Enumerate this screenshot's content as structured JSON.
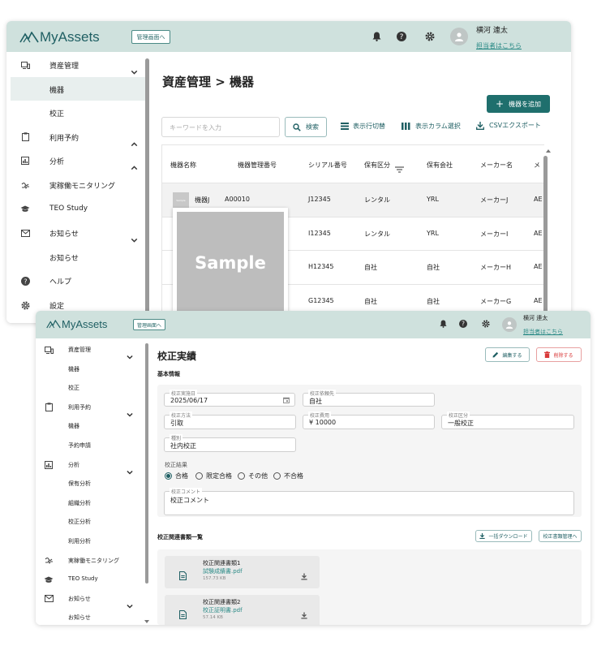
{
  "app": {
    "logo_text": "MyAssets",
    "mgmt_button": "管理画面へ",
    "user_name": "横河 連太",
    "contact_link": "担当者はこちら"
  },
  "colors": {
    "accent": "#1f6f6d",
    "header_bg": "#cfe1dd",
    "danger": "#d93a3a"
  },
  "win1": {
    "sidebar": [
      {
        "icon": "asset-icon",
        "label": "資産管理",
        "chevron": "down"
      },
      {
        "icon": "",
        "label": "機器",
        "selected": true
      },
      {
        "icon": "",
        "label": "校正"
      },
      {
        "icon": "clipboard-icon",
        "label": "利用予約",
        "chevron": "up"
      },
      {
        "icon": "chart-icon",
        "label": "分析",
        "chevron": "up"
      },
      {
        "icon": "monitor-icon",
        "label": "実稼働モニタリング"
      },
      {
        "icon": "graduation-icon",
        "label": "TEO Study"
      },
      {
        "icon": "mail-icon",
        "label": "お知らせ",
        "chevron": "down"
      },
      {
        "icon": "",
        "label": "お知らせ"
      },
      {
        "icon": "help-icon",
        "label": "ヘルプ"
      },
      {
        "icon": "gear-icon",
        "label": "設定"
      }
    ],
    "page_title": "資産管理 > 機器",
    "add_button": "機器を追加",
    "search_placeholder": "キーワードを入力",
    "search_button": "検索",
    "toolbar": {
      "rows_toggle": "表示行切替",
      "column_select": "表示カラム選択",
      "csv_export": "CSVエクスポート"
    },
    "table": {
      "headers": [
        "機器名称",
        "機器管理番号",
        "シリアル番号",
        "保有区分",
        "保有会社",
        "メーカー名",
        "メ"
      ],
      "rows": [
        [
          "機器J",
          "A00010",
          "J12345",
          "レンタル",
          "YRL",
          "メーカーJ",
          "AE"
        ],
        [
          "",
          "",
          "I12345",
          "レンタル",
          "YRL",
          "メーカーI",
          "AE"
        ],
        [
          "",
          "",
          "H12345",
          "自社",
          "自社",
          "メーカーH",
          "AE"
        ],
        [
          "",
          "",
          "G12345",
          "自社",
          "自社",
          "メーカーG",
          "AE"
        ]
      ],
      "thumb_text": "Sample",
      "popup_text": "Sample"
    }
  },
  "win2": {
    "sidebar": [
      {
        "icon": "asset-icon",
        "label": "資産管理",
        "chevron": "down"
      },
      {
        "icon": "",
        "label": "機器"
      },
      {
        "icon": "",
        "label": "校正"
      },
      {
        "icon": "clipboard-icon",
        "label": "利用予約",
        "chevron": "down"
      },
      {
        "icon": "",
        "label": "機器"
      },
      {
        "icon": "",
        "label": "予約申請"
      },
      {
        "icon": "chart-icon",
        "label": "分析",
        "chevron": "down"
      },
      {
        "icon": "",
        "label": "保有分析"
      },
      {
        "icon": "",
        "label": "組織分析"
      },
      {
        "icon": "",
        "label": "校正分析"
      },
      {
        "icon": "",
        "label": "利用分析"
      },
      {
        "icon": "monitor-icon",
        "label": "実稼働モニタリング"
      },
      {
        "icon": "graduation-icon",
        "label": "TEO Study"
      },
      {
        "icon": "mail-icon",
        "label": "お知らせ",
        "chevron": "down"
      },
      {
        "icon": "",
        "label": "お知らせ"
      }
    ],
    "page_title": "校正実績",
    "edit_button": "編集する",
    "delete_button": "削除する",
    "section_basic": "基本情報",
    "fields": {
      "cal_date_label": "校正実施日",
      "cal_date_value": "2025/06/17",
      "requester_label": "校正依頼先",
      "requester_value": "自社",
      "method_label": "校正方法",
      "method_value": "引取",
      "cost_label": "校正費用",
      "cost_value": "¥  10000",
      "category_label": "校正区分",
      "category_value": "一般校正",
      "type_label": "種別",
      "type_value": "社内校正",
      "result_label": "校正結果",
      "comment_label": "校正コメント",
      "comment_value": "校正コメント"
    },
    "results": [
      "合格",
      "限定合格",
      "その他",
      "不合格"
    ],
    "docs_title": "校正関連書類一覧",
    "bulk_download": "一括ダウンロード",
    "doc_manage": "校正書類管理へ",
    "docs": [
      {
        "title": "校正関連書類1",
        "file": "試験成績書.pdf",
        "size": "157.73 KB"
      },
      {
        "title": "校正関連書類2",
        "file": "校正証明書.pdf",
        "size": "57.14 KB"
      }
    ]
  }
}
